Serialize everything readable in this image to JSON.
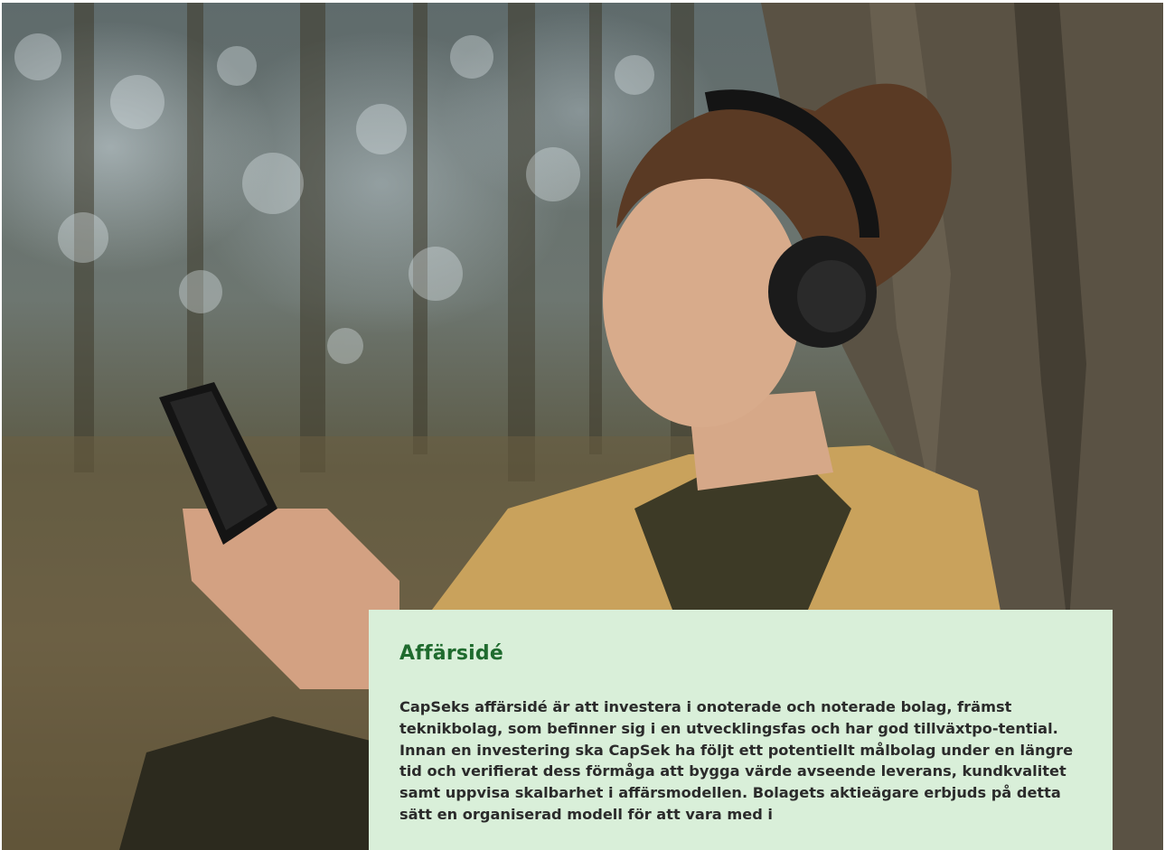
{
  "hero_image": {
    "alt": "Woman wearing headphones looking at a smartphone while leaning against a tree in a forest"
  },
  "business_idea": {
    "title": "Affärsidé",
    "body": "CapSeks affärsidé är att investera i onoterade och noterade bolag, främst teknikbolag, som befinner sig i en utvecklingsfas och har god tillväxtpo-tential. Innan en investering ska CapSek ha följt ett potentiellt målbolag under en längre tid och verifierat dess förmåga att bygga värde avseende leverans, kundkvalitet samt uppvisa skalbarhet i affärsmodellen. Bolagets aktieägare erbjuds på detta sätt en organiserad modell för att vara med i"
  },
  "colors": {
    "card_background": "#d9efd9",
    "title": "#1f6b2e",
    "body_text": "#2b2b2b"
  }
}
